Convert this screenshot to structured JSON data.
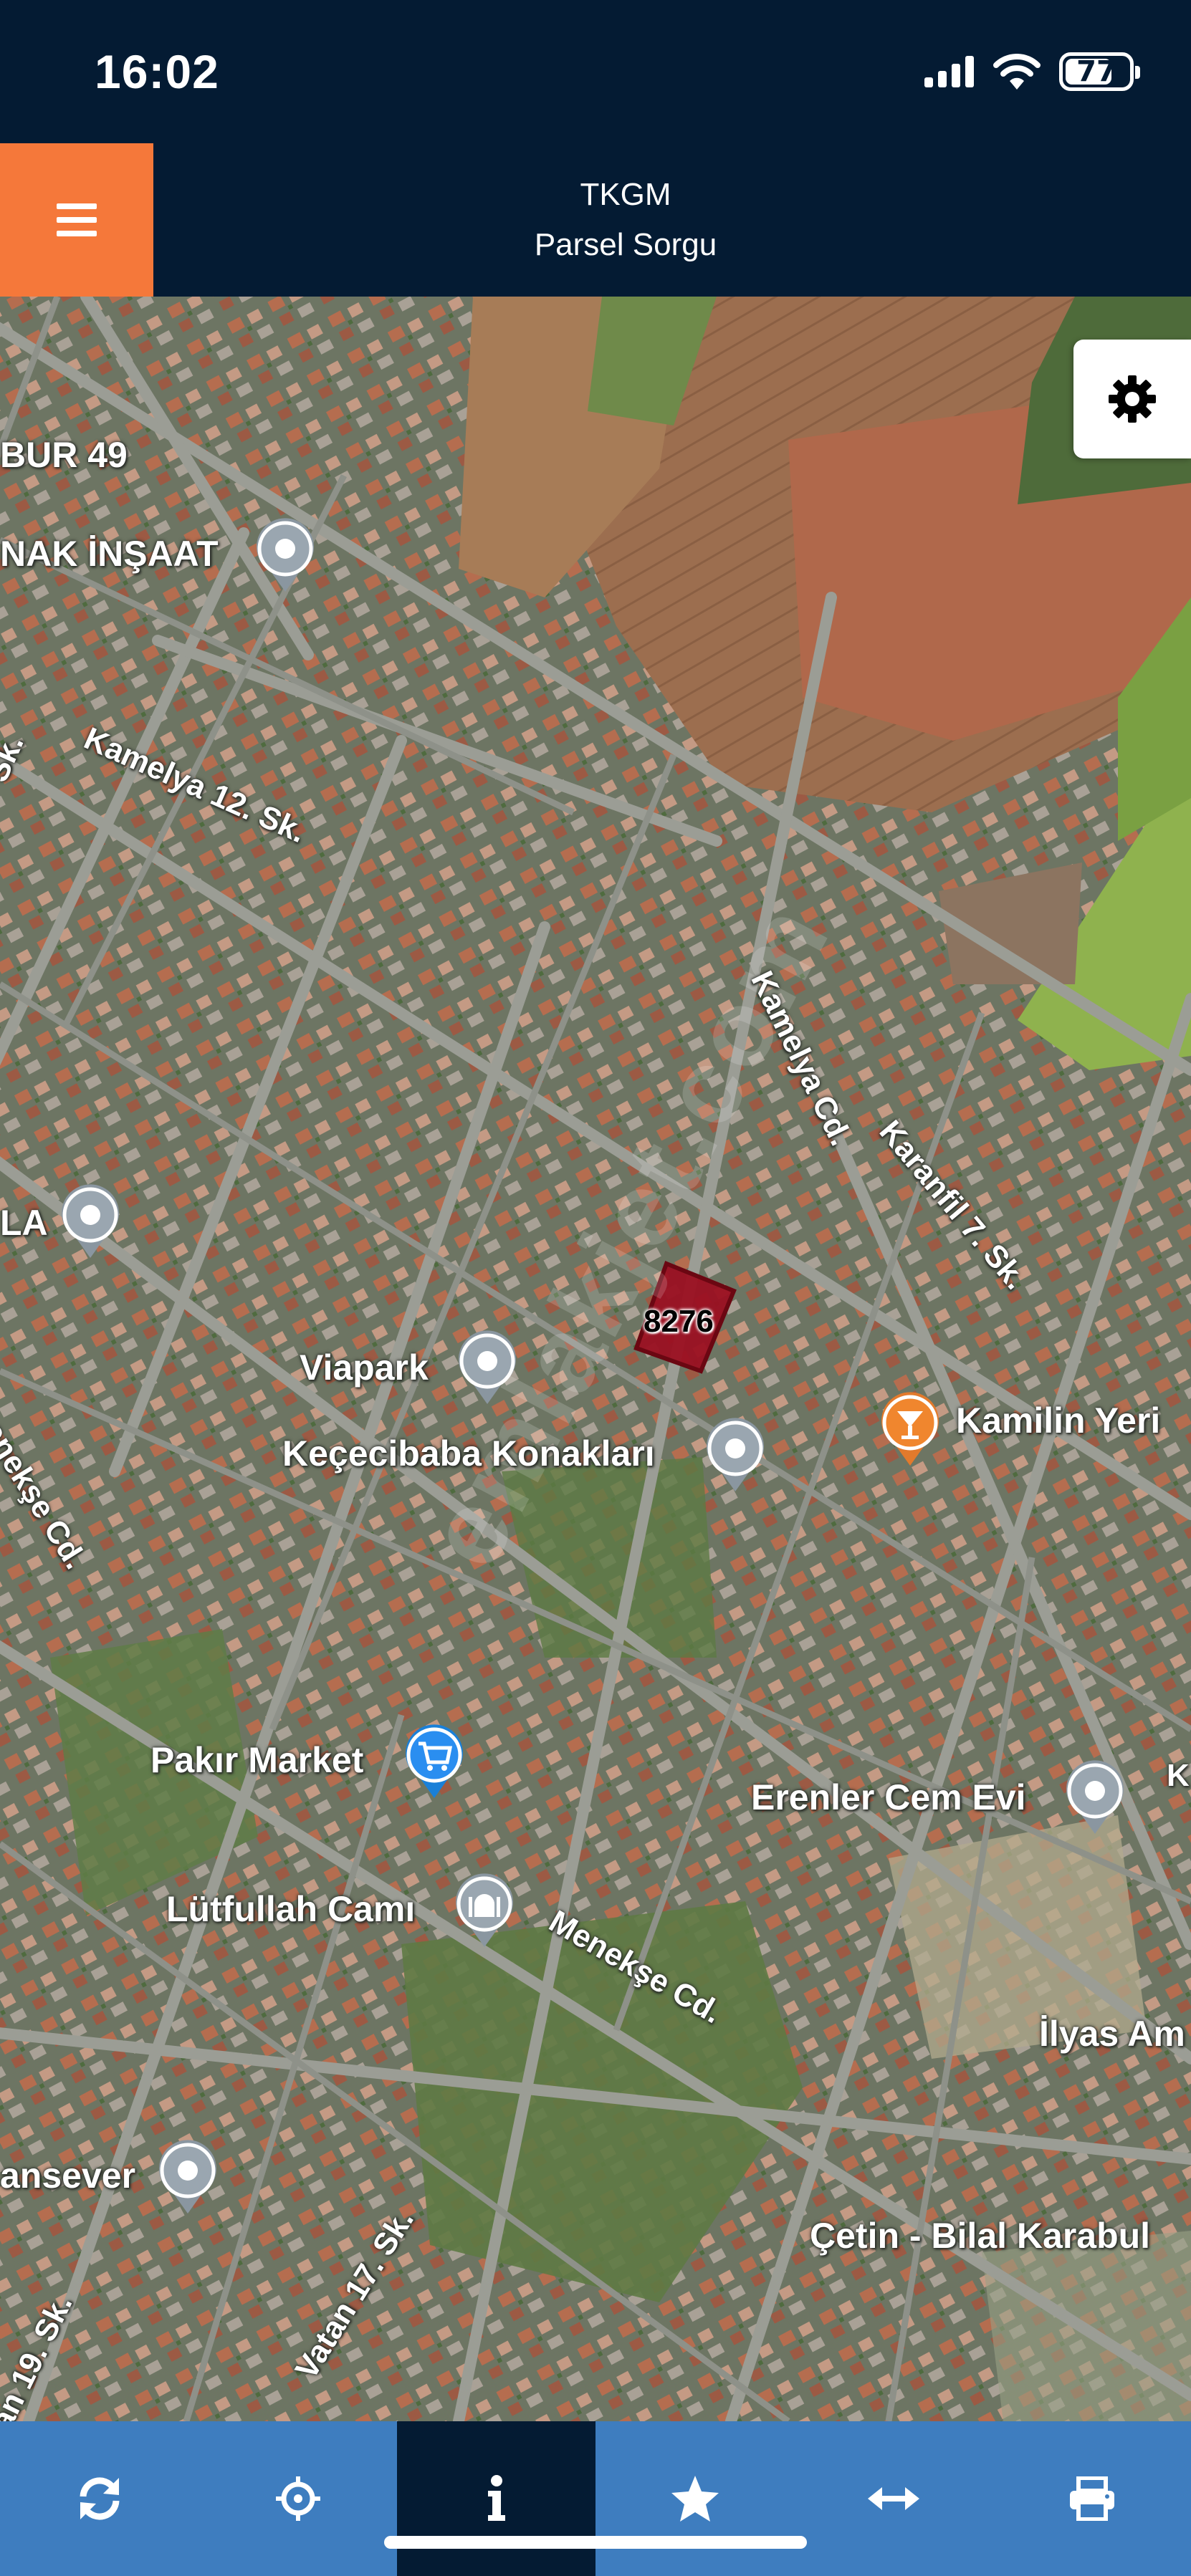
{
  "status_bar": {
    "time": "16:02",
    "battery": "77",
    "battery_level_percent": 77,
    "icons": [
      "cellular-signal-icon",
      "wifi-icon",
      "battery-icon"
    ]
  },
  "header": {
    "title": "TKGM",
    "subtitle": "Parsel Sorgu",
    "menu_icon": "hamburger-menu-icon",
    "colors": {
      "background": "#041b33",
      "menu_button": "#f5783a"
    }
  },
  "map": {
    "settings_icon": "gear-icon",
    "parcel_number": "8276",
    "watermark": "emlakjet.com",
    "labels": {
      "bur49": "BUR 49",
      "nak_insaat": "NAK İNŞAAT",
      "kamelya_12": "Kamelya 12. Sk.",
      "sk_left": "Sk.",
      "kamelya_cd": "Kamelya Cd.",
      "karanfil_7": "Karanfil 7. Sk.",
      "la": "LA",
      "viapark": "Viapark",
      "kececibaba": "Keçecibaba Konakları",
      "kamilin_yeri": "Kamilin Yeri",
      "menekse_cd_left": "enekşe Cd.",
      "pakir_market": "Pakır Market",
      "erenler_cem_evi": "Erenler Cem Evi",
      "lutfullah_cami": "Lütfullah Camı",
      "menekse_cd": "Menekşe Cd.",
      "ilyas_am": "İlyas Am",
      "ansever": "ansever",
      "cetin_bilal": "Çetin - Bilal Karabul",
      "vatan_17": "Vatan 17. Sk.",
      "sk19": "an 19. Sk.",
      "edge_k": "K"
    },
    "pins": [
      "location-pin-icon",
      "location-pin-icon",
      "location-pin-icon",
      "location-pin-icon",
      "bar-cocktail-pin-icon",
      "shopping-cart-pin-icon",
      "location-pin-icon",
      "mosque-pin-icon",
      "location-pin-icon"
    ]
  },
  "toolbar": {
    "items": [
      {
        "icon": "refresh-icon"
      },
      {
        "icon": "crosshair-locate-icon"
      },
      {
        "icon": "info-icon",
        "active": true
      },
      {
        "icon": "star-icon"
      },
      {
        "icon": "measure-arrows-icon"
      },
      {
        "icon": "print-icon"
      }
    ],
    "colors": {
      "background": "#3e7dbf",
      "active": "#041b33"
    }
  }
}
